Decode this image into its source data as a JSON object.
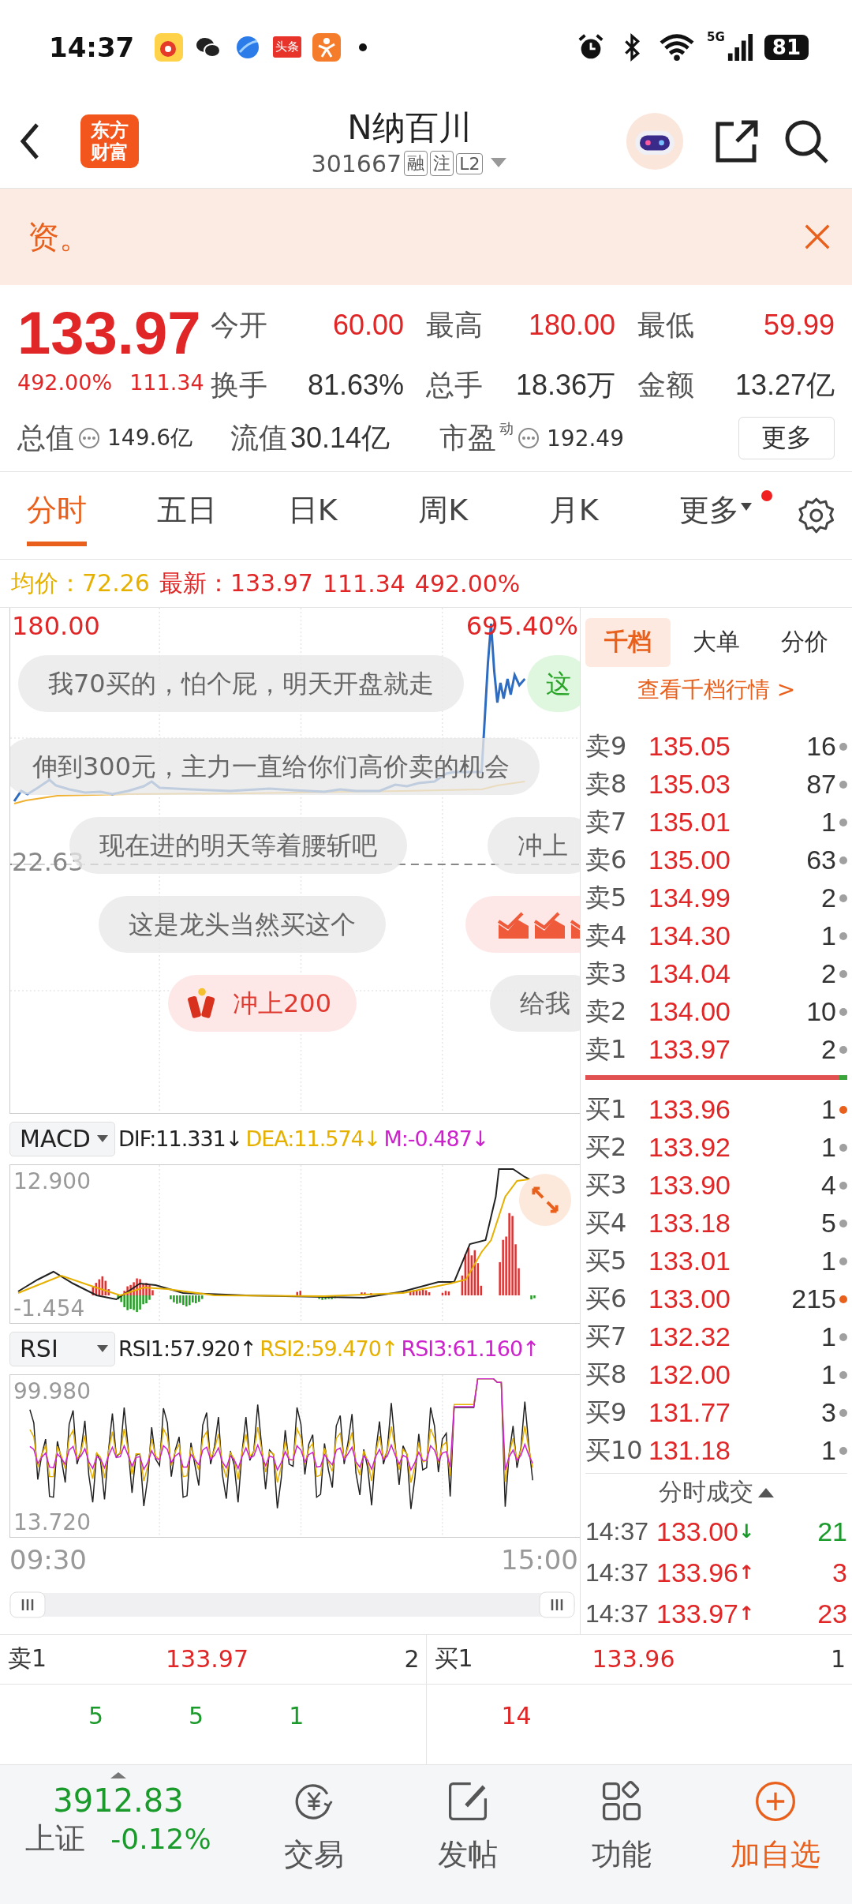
{
  "status_bar": {
    "time": "14:37",
    "notice_badge": "头条",
    "network": "5G",
    "battery": "81"
  },
  "header": {
    "logo": "东方财富",
    "title": "N纳百川",
    "code": "301667",
    "badges": [
      "融",
      "注",
      "L2"
    ]
  },
  "banner": {
    "text": "资。"
  },
  "quote": {
    "price": "133.97",
    "change_pct": "492.00%",
    "change": "111.34",
    "stats": [
      {
        "label": "今开",
        "value": "60.00",
        "rising": true
      },
      {
        "label": "最高",
        "value": "180.00",
        "rising": true
      },
      {
        "label": "最低",
        "value": "59.99",
        "rising": true
      },
      {
        "label": "换手",
        "value": "81.63%",
        "rising": false
      },
      {
        "label": "总手",
        "value": "18.36万",
        "rising": false
      },
      {
        "label": "金额",
        "value": "13.27亿",
        "rising": false
      }
    ],
    "valuation": [
      {
        "label": "总值",
        "info": true,
        "value": "149.6亿"
      },
      {
        "label": "流值",
        "info": false,
        "value": "30.14亿"
      },
      {
        "label": "市盈",
        "sup": "动",
        "info": true,
        "value": "192.49"
      }
    ],
    "more_button": "更多"
  },
  "chart_tabs": [
    {
      "label": "分时",
      "selected": true,
      "dropdown": false,
      "dot": false
    },
    {
      "label": "五日",
      "selected": false,
      "dropdown": false,
      "dot": false
    },
    {
      "label": "日K",
      "selected": false,
      "dropdown": false,
      "dot": false
    },
    {
      "label": "周K",
      "selected": false,
      "dropdown": false,
      "dot": false
    },
    {
      "label": "月K",
      "selected": false,
      "dropdown": false,
      "dot": false
    },
    {
      "label": "更多",
      "selected": false,
      "dropdown": true,
      "dot": true
    }
  ],
  "price_bar": {
    "avg_label": "均价：",
    "avg": "72.26",
    "latest_label": "最新：",
    "latest": "133.97",
    "change": "111.34",
    "change_pct": "492.00%"
  },
  "main_chart": {
    "high": "180.00",
    "high_pct": "695.40%",
    "ref": "22.63"
  },
  "comments": [
    {
      "text": "我70买的，怕个屁，明天开盘就走",
      "kind": "plain"
    },
    {
      "text": "这",
      "kind": "green"
    },
    {
      "text": "伸到300元，主力一直给你们高价卖的机会",
      "kind": "plain"
    },
    {
      "text": "现在进的明天等着腰斩吧",
      "kind": "plain"
    },
    {
      "text": "冲上",
      "kind": "plain"
    },
    {
      "text": "这是龙头当然买这个",
      "kind": "plain"
    },
    {
      "kind": "emoji"
    },
    {
      "text": "冲上200",
      "kind": "gift"
    },
    {
      "text": "给我",
      "kind": "plain"
    }
  ],
  "macd": {
    "selector": "MACD",
    "values": [
      {
        "text": "DIF:11.331↓",
        "color": "#222222"
      },
      {
        "text": "DEA:11.574↓",
        "color": "#e6b000"
      },
      {
        "text": "M:-0.487↓",
        "color": "#cc22cc"
      }
    ],
    "max": "12.900",
    "min": "-1.454"
  },
  "rsi": {
    "selector": "RSI",
    "values": [
      {
        "text": "RSI1:57.920↑",
        "color": "#222222"
      },
      {
        "text": "RSI2:59.470↑",
        "color": "#e6b000"
      },
      {
        "text": "RSI3:61.160↑",
        "color": "#cc22cc"
      }
    ],
    "max": "99.980",
    "min": "13.720"
  },
  "time_axis": [
    "09:30",
    "15:00"
  ],
  "book": {
    "tabs": [
      {
        "label": "千档",
        "selected": true
      },
      {
        "label": "大单",
        "selected": false
      },
      {
        "label": "分价",
        "selected": false
      }
    ],
    "link": "查看千档行情 >",
    "asks": [
      {
        "label": "卖9",
        "price": "135.05",
        "volume": "16",
        "color": "#a0a0a0"
      },
      {
        "label": "卖8",
        "price": "135.03",
        "volume": "87",
        "color": "#a0a0a0"
      },
      {
        "label": "卖7",
        "price": "135.01",
        "volume": "1",
        "color": "#a0a0a0"
      },
      {
        "label": "卖6",
        "price": "135.00",
        "volume": "63",
        "color": "#a0a0a0"
      },
      {
        "label": "卖5",
        "price": "134.99",
        "volume": "2",
        "color": "#a0a0a0"
      },
      {
        "label": "卖4",
        "price": "134.30",
        "volume": "1",
        "color": "#a0a0a0"
      },
      {
        "label": "卖3",
        "price": "134.04",
        "volume": "2",
        "color": "#a0a0a0"
      },
      {
        "label": "卖2",
        "price": "134.00",
        "volume": "10",
        "color": "#a0a0a0"
      },
      {
        "label": "卖1",
        "price": "133.97",
        "volume": "2",
        "color": "#a0a0a0"
      }
    ],
    "ratio": {
      "level": 0.97
    },
    "bids": [
      {
        "label": "买1",
        "price": "133.96",
        "volume": "1",
        "color": "#e8601c"
      },
      {
        "label": "买2",
        "price": "133.92",
        "volume": "1",
        "color": "#a0a0a0"
      },
      {
        "label": "买3",
        "price": "133.90",
        "volume": "4",
        "color": "#a0a0a0"
      },
      {
        "label": "买4",
        "price": "133.18",
        "volume": "5",
        "color": "#a0a0a0"
      },
      {
        "label": "买5",
        "price": "133.01",
        "volume": "1",
        "color": "#a0a0a0"
      },
      {
        "label": "买6",
        "price": "133.00",
        "volume": "215",
        "color": "#e8601c"
      },
      {
        "label": "买7",
        "price": "132.32",
        "volume": "1",
        "color": "#a0a0a0"
      },
      {
        "label": "买8",
        "price": "132.00",
        "volume": "1",
        "color": "#a0a0a0"
      },
      {
        "label": "买9",
        "price": "131.77",
        "volume": "3",
        "color": "#a0a0a0"
      },
      {
        "label": "买10",
        "price": "131.18",
        "volume": "1",
        "color": "#a0a0a0"
      }
    ],
    "trades_title": "分时成交",
    "trades": [
      {
        "time": "14:37",
        "price": "133.00",
        "arrow": "↓",
        "volume": "21",
        "kind": "down"
      },
      {
        "time": "14:37",
        "price": "133.96",
        "arrow": "↑",
        "volume": "3",
        "kind": "up"
      },
      {
        "time": "14:37",
        "price": "133.97",
        "arrow": "↑",
        "volume": "23",
        "kind": "up"
      }
    ]
  },
  "best_quotes": [
    {
      "label": "卖1",
      "price": "133.97",
      "volume": "2",
      "queue": [
        "5",
        "5",
        "1"
      ],
      "kind": "ask"
    },
    {
      "label": "买1",
      "price": "133.96",
      "volume": "1",
      "queue": [
        "14"
      ],
      "kind": "bid"
    }
  ],
  "bottom_nav": {
    "index": {
      "value": "3912.83",
      "name": "上证",
      "change": "-0.12%"
    },
    "items": [
      {
        "label": "交易",
        "kind": "trade",
        "highlighted": false
      },
      {
        "label": "发帖",
        "kind": "post",
        "highlighted": false
      },
      {
        "label": "功能",
        "kind": "apps",
        "highlighted": false
      },
      {
        "label": "加自选",
        "kind": "add",
        "highlighted": true
      }
    ]
  }
}
